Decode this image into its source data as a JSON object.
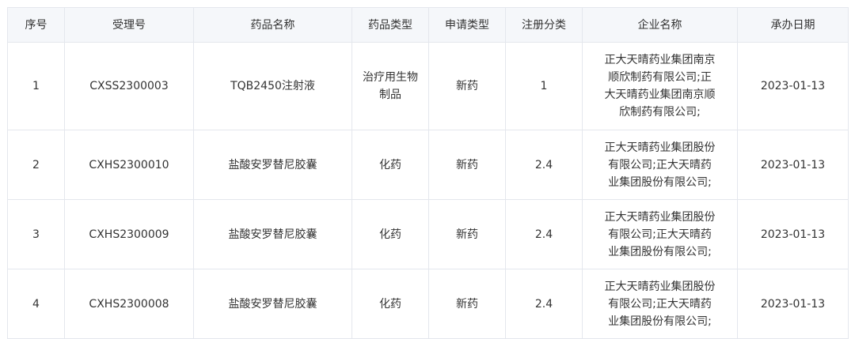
{
  "headers": [
    "序号",
    "受理号",
    "药品名称",
    "药品类型",
    "申请类型",
    "注册分类",
    "企业名称",
    "承办日期"
  ],
  "rows": [
    {
      "index": "1",
      "acceptance_no": "CXSS2300003",
      "drug_name": "TQB2450注射液",
      "drug_type": "治疗用生物制品",
      "application_type": "新药",
      "registration_class": "1",
      "company": "正大天晴药业集团南京顺欣制药有限公司;正大天晴药业集团南京顺欣制药有限公司;",
      "date": "2023-01-13"
    },
    {
      "index": "2",
      "acceptance_no": "CXHS2300010",
      "drug_name": "盐酸安罗替尼胶囊",
      "drug_type": "化药",
      "application_type": "新药",
      "registration_class": "2.4",
      "company": "正大天晴药业集团股份有限公司;正大天晴药业集团股份有限公司;",
      "date": "2023-01-13"
    },
    {
      "index": "3",
      "acceptance_no": "CXHS2300009",
      "drug_name": "盐酸安罗替尼胶囊",
      "drug_type": "化药",
      "application_type": "新药",
      "registration_class": "2.4",
      "company": "正大天晴药业集团股份有限公司;正大天晴药业集团股份有限公司;",
      "date": "2023-01-13"
    },
    {
      "index": "4",
      "acceptance_no": "CXHS2300008",
      "drug_name": "盐酸安罗替尼胶囊",
      "drug_type": "化药",
      "application_type": "新药",
      "registration_class": "2.4",
      "company": "正大天晴药业集团股份有限公司;正大天晴药业集团股份有限公司;",
      "date": "2023-01-13"
    }
  ]
}
